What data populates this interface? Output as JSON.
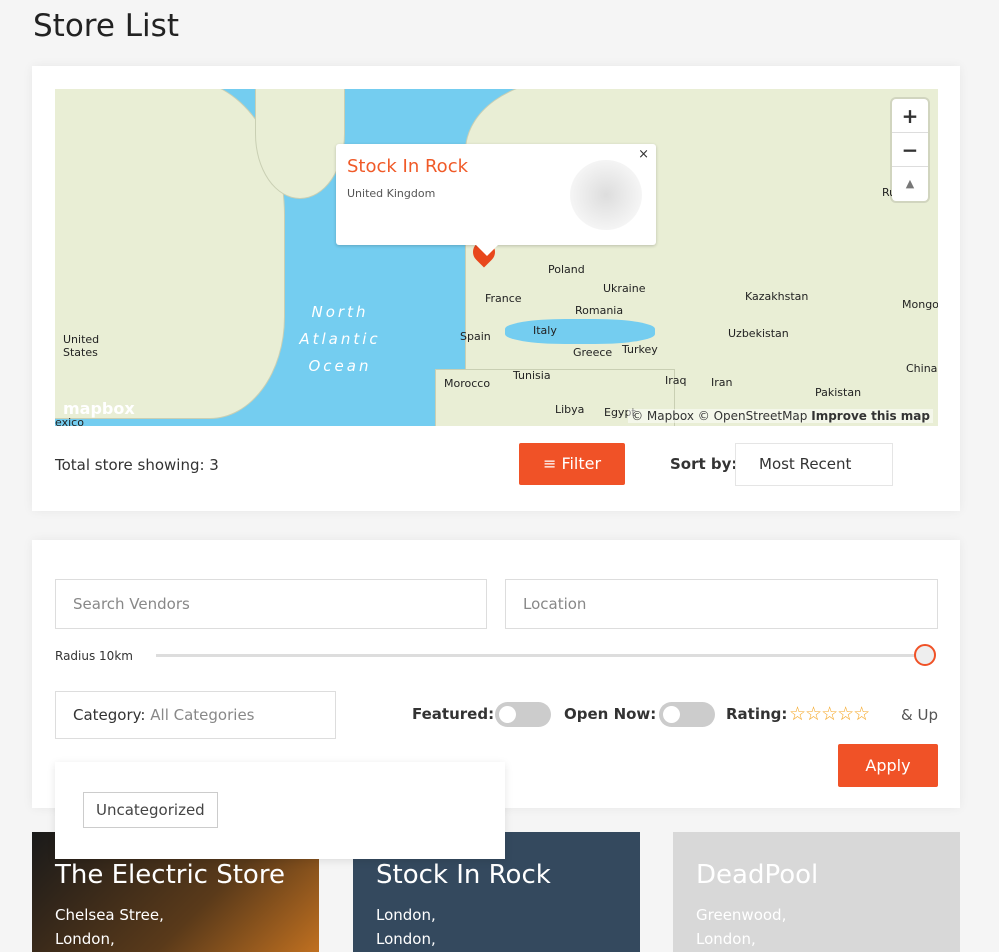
{
  "page": {
    "title": "Store List"
  },
  "map": {
    "labels": [
      {
        "text": "Poland"
      },
      {
        "text": "Ukraine"
      },
      {
        "text": "France"
      },
      {
        "text": "Romania"
      },
      {
        "text": "Kazakhstan"
      },
      {
        "text": "Mongo"
      },
      {
        "text": "Spain"
      },
      {
        "text": "Italy"
      },
      {
        "text": "Uzbekistan"
      },
      {
        "text": "Greece"
      },
      {
        "text": "Turkey"
      },
      {
        "text": "China"
      },
      {
        "text": "United States"
      },
      {
        "text": "Morocco"
      },
      {
        "text": "Tunisia"
      },
      {
        "text": "Iraq"
      },
      {
        "text": "Iran"
      },
      {
        "text": "Pakistan"
      },
      {
        "text": "Libya"
      },
      {
        "text": "Egypt"
      },
      {
        "text": "Ru"
      },
      {
        "text": "exico"
      }
    ],
    "ocean": "North Atlantic Ocean",
    "logo": "mapbox",
    "attribution": "© Mapbox © OpenStreetMap",
    "improve": "Improve this map",
    "zoom_in": "+",
    "zoom_out": "−",
    "compass": "▲",
    "popup": {
      "title": "Stock In Rock",
      "subtitle": "United Kingdom",
      "close": "×"
    }
  },
  "toolbar": {
    "total": "Total store showing: 3",
    "filter": "Filter",
    "sort_label": "Sort by:",
    "sort_value": "Most Recent"
  },
  "filters": {
    "search_placeholder": "Search Vendors",
    "location_placeholder": "Location",
    "radius": "Radius 10km",
    "category_label": "Category:",
    "category_value": "All Categories",
    "featured": "Featured:",
    "open_now": "Open Now:",
    "rating": "Rating:",
    "stars": "☆☆☆☆☆",
    "rating_suffix": "& Up",
    "apply": "Apply",
    "rating_value": 0,
    "featured_on": false,
    "open_now_on": false,
    "dropdown": [
      "Uncategorized"
    ]
  },
  "stores": [
    {
      "name": "The Electric Store",
      "line1": "Chelsea Stree,",
      "line2": "London,"
    },
    {
      "name": "Stock In Rock",
      "line1": "London,",
      "line2": "London,"
    },
    {
      "name": "DeadPool",
      "line1": "Greenwood,",
      "line2": "London,"
    }
  ],
  "colors": {
    "accent": "#f05227",
    "water": "#74cdf0",
    "land": "#e9eed5"
  }
}
